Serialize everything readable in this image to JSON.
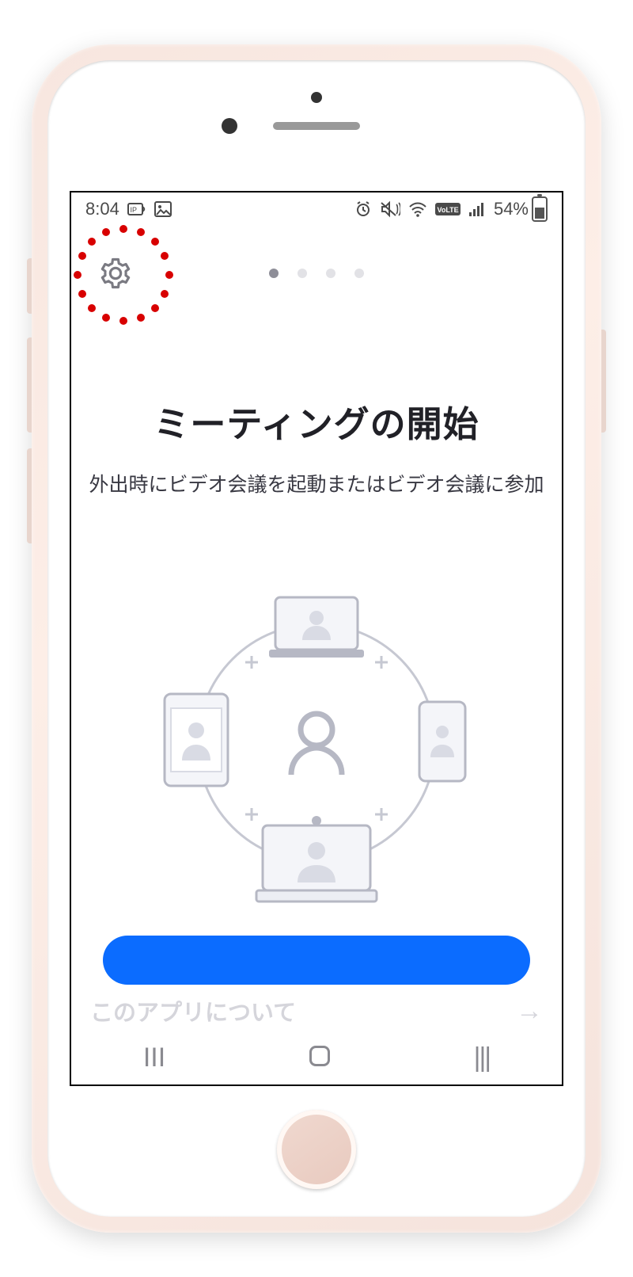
{
  "statusbar": {
    "time": "8:04",
    "battery_pct": "54%"
  },
  "header": {
    "page_index_active": 0,
    "page_count": 4
  },
  "hero": {
    "title": "ミーティングの開始",
    "subtitle": "外出時にビデオ会議を起動またはビデオ会議に参加"
  },
  "footer": {
    "about_label": "このアプリについて",
    "arrow_glyph": "→"
  },
  "nav": {
    "recent_glyph": "III"
  },
  "annotation": {
    "highlight_target": "settings-button"
  },
  "colors": {
    "accent": "#0b6cff"
  }
}
